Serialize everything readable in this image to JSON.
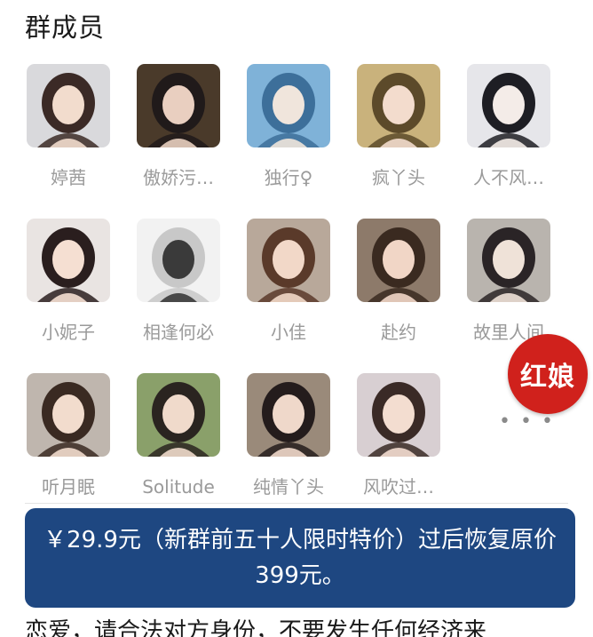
{
  "section": {
    "title": "群成员"
  },
  "members": [
    {
      "name": "婷茜",
      "icon": "avatar-photo",
      "colors": [
        "#d9d9dc",
        "#3b2a26",
        "#f2dccd"
      ]
    },
    {
      "name": "傲娇污…",
      "icon": "avatar-photo",
      "colors": [
        "#4a3a2a",
        "#201a1a",
        "#e9cfc0"
      ]
    },
    {
      "name": "独行♀",
      "icon": "avatar-photo",
      "colors": [
        "#7fb2d8",
        "#3d6f9a",
        "#f0e5dc"
      ]
    },
    {
      "name": "疯丫头",
      "icon": "avatar-photo",
      "colors": [
        "#c9b27c",
        "#5c4a2a",
        "#f3dccd"
      ]
    },
    {
      "name": "人不风…",
      "icon": "avatar-photo",
      "colors": [
        "#e6e6ea",
        "#1e1e24",
        "#f4ece8"
      ]
    },
    {
      "name": "小妮子",
      "icon": "avatar-photo",
      "colors": [
        "#e9e4e2",
        "#2a1e1e",
        "#f5dfd2"
      ]
    },
    {
      "name": "相逢何必",
      "icon": "avatar-photo",
      "colors": [
        "#f2f2f2",
        "#c8c8c8",
        "#3a3a3a"
      ]
    },
    {
      "name": "小佳",
      "icon": "avatar-photo",
      "colors": [
        "#b8a89a",
        "#5a3a2a",
        "#f2d8c8"
      ]
    },
    {
      "name": "赴约",
      "icon": "avatar-photo",
      "colors": [
        "#8d7a6a",
        "#3a2a20",
        "#f1d6c6"
      ]
    },
    {
      "name": "故里人间",
      "icon": "avatar-photo",
      "colors": [
        "#b9b4ae",
        "#2a2426",
        "#efe2d8"
      ]
    },
    {
      "name": "听月眠",
      "icon": "avatar-photo",
      "colors": [
        "#bfb6ae",
        "#3a2a22",
        "#f2dccd"
      ]
    },
    {
      "name": "Solitude",
      "icon": "avatar-photo",
      "colors": [
        "#8aa06a",
        "#2a2420",
        "#f0dacb"
      ]
    },
    {
      "name": "纯情丫头",
      "icon": "avatar-photo",
      "colors": [
        "#9a8a7a",
        "#241c1c",
        "#efd8ca"
      ]
    },
    {
      "name": "风吹过…",
      "icon": "avatar-photo",
      "colors": [
        "#d8cfd2",
        "#3a2a26",
        "#f3ddd0"
      ]
    }
  ],
  "more": {
    "label": "• • •"
  },
  "badge": {
    "label": "红娘",
    "color": "#d0211c"
  },
  "banner": {
    "text": "￥29.9元（新群前五十人限时特价）过后恢复原价399元。",
    "color": "#1e4781"
  },
  "footer": {
    "text": "恋爱，请合法对方身份，不要发生任何经济来"
  }
}
